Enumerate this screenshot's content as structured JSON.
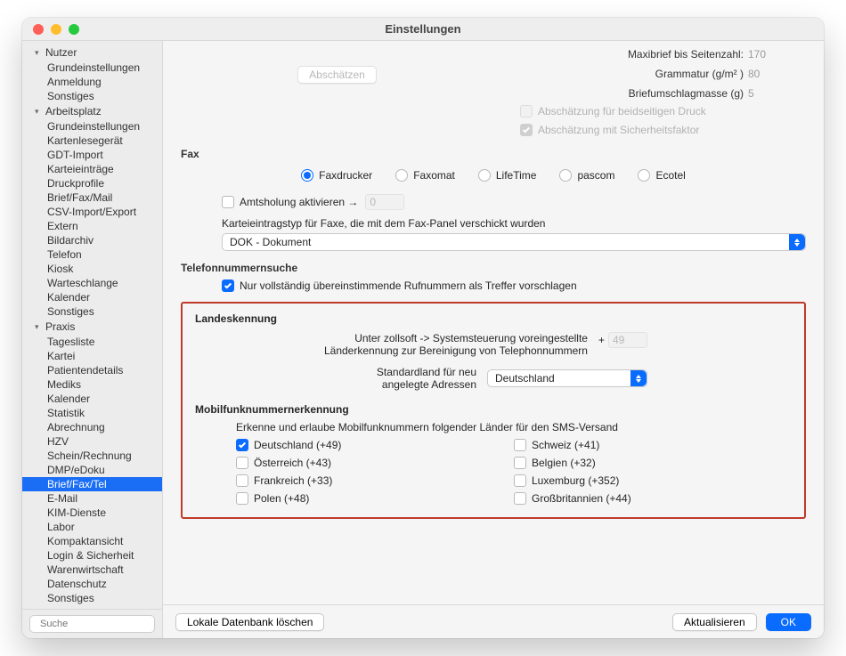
{
  "title": "Einstellungen",
  "sidebar": {
    "search_placeholder": "Suche",
    "groups": [
      {
        "label": "Nutzer",
        "items": [
          "Grundeinstellungen",
          "Anmeldung",
          "Sonstiges"
        ]
      },
      {
        "label": "Arbeitsplatz",
        "items": [
          "Grundeinstellungen",
          "Kartenlesegerät",
          "GDT-Import",
          "Karteieinträge",
          "Druckprofile",
          "Brief/Fax/Mail",
          "CSV-Import/Export",
          "Extern",
          "Bildarchiv",
          "Telefon",
          "Kiosk",
          "Warteschlange",
          "Kalender",
          "Sonstiges"
        ]
      },
      {
        "label": "Praxis",
        "items": [
          "Tagesliste",
          "Kartei",
          "Patientendetails",
          "Mediks",
          "Kalender",
          "Statistik",
          "Abrechnung",
          "HZV",
          "Schein/Rechnung",
          "DMP/eDoku",
          "Brief/Fax/Tel",
          "E-Mail",
          "KIM-Dienste",
          "Labor",
          "Kompaktansicht",
          "Login & Sicherheit",
          "Warenwirtschaft",
          "Datenschutz",
          "Sonstiges"
        ]
      }
    ],
    "selected": "Brief/Fax/Tel"
  },
  "top": {
    "estimate_btn": "Abschätzen",
    "maxibrief_label": "Maxibrief bis Seitenzahl:",
    "maxibrief_value": "170",
    "grammatur_label": "Grammatur (g/m² )",
    "grammatur_value": "80",
    "umschlag_label": "Briefumschlagmasse (g)",
    "umschlag_value": "5",
    "duplex": "Abschätzung für beidseitigen Druck",
    "safety": "Abschätzung mit Sicherheitsfaktor"
  },
  "fax": {
    "title": "Fax",
    "options": [
      "Faxdrucker",
      "Faxomat",
      "LifeTime",
      "pascom",
      "Ecotel"
    ],
    "selected": "Faxdrucker",
    "amts_label": "Amtsholung aktivieren →",
    "amts_value": "0",
    "typ_label": "Karteieintragstyp für Faxe, die mit dem Fax-Panel verschickt wurden",
    "typ_selected": "DOK - Dokument"
  },
  "phone": {
    "title": "Telefonnummernsuche",
    "exact": "Nur vollständig übereinstimmende Rufnummern als Treffer vorschlagen"
  },
  "landeskennung": {
    "title": "Landeskennung",
    "line1a": "Unter zollsoft -> Systemsteuerung voreingestellte",
    "line1b": "Länderkennung zur Bereinigung von Telephonnummern",
    "plus": "+",
    "code": "49",
    "std_label_a": "Standardland für neu",
    "std_label_b": "angelegte Adressen",
    "std_selected": "Deutschland"
  },
  "mobil": {
    "title": "Mobilfunknummernerkennung",
    "intro": "Erkenne und erlaube Mobilfunknummern folgender Länder für den SMS-Versand",
    "col1": [
      "Deutschland (+49)",
      "Österreich (+43)",
      "Frankreich (+33)",
      "Polen (+48)"
    ],
    "col2": [
      "Schweiz (+41)",
      "Belgien (+32)",
      "Luxemburg (+352)",
      "Großbritannien (+44)"
    ],
    "checked": [
      "Deutschland (+49)"
    ]
  },
  "footer": {
    "local": "Lokale Datenbank löschen",
    "refresh": "Aktualisieren",
    "ok": "OK"
  }
}
